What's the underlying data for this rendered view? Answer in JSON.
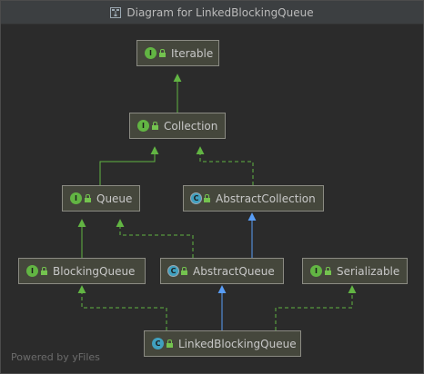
{
  "window": {
    "title": "Diagram for LinkedBlockingQueue"
  },
  "nodes": {
    "iterable": {
      "label": "Iterable",
      "kind": "interface",
      "badge": "I"
    },
    "collection": {
      "label": "Collection",
      "kind": "interface",
      "badge": "I"
    },
    "queue": {
      "label": "Queue",
      "kind": "interface",
      "badge": "I"
    },
    "abstract_collection": {
      "label": "AbstractCollection",
      "kind": "abstract-class",
      "badge": "C"
    },
    "blocking_queue": {
      "label": "BlockingQueue",
      "kind": "interface",
      "badge": "I"
    },
    "abstract_queue": {
      "label": "AbstractQueue",
      "kind": "abstract-class",
      "badge": "C"
    },
    "serializable": {
      "label": "Serializable",
      "kind": "interface",
      "badge": "I"
    },
    "linked_blocking_queue": {
      "label": "LinkedBlockingQueue",
      "kind": "class",
      "badge": "C"
    }
  },
  "edges": [
    {
      "from": "Collection",
      "to": "Iterable",
      "type": "extends"
    },
    {
      "from": "Queue",
      "to": "Collection",
      "type": "extends"
    },
    {
      "from": "AbstractCollection",
      "to": "Collection",
      "type": "implements"
    },
    {
      "from": "BlockingQueue",
      "to": "Queue",
      "type": "extends"
    },
    {
      "from": "AbstractQueue",
      "to": "Queue",
      "type": "implements"
    },
    {
      "from": "AbstractQueue",
      "to": "AbstractCollection",
      "type": "extends-class"
    },
    {
      "from": "LinkedBlockingQueue",
      "to": "BlockingQueue",
      "type": "implements"
    },
    {
      "from": "LinkedBlockingQueue",
      "to": "AbstractQueue",
      "type": "extends-class"
    },
    {
      "from": "LinkedBlockingQueue",
      "to": "Serializable",
      "type": "implements"
    }
  ],
  "colors": {
    "interface_edge": "#62b543",
    "class_edge": "#589df6",
    "background": "#2b2b2b",
    "node_fill": "#45473c"
  },
  "footer": {
    "text": "Powered by yFiles"
  }
}
